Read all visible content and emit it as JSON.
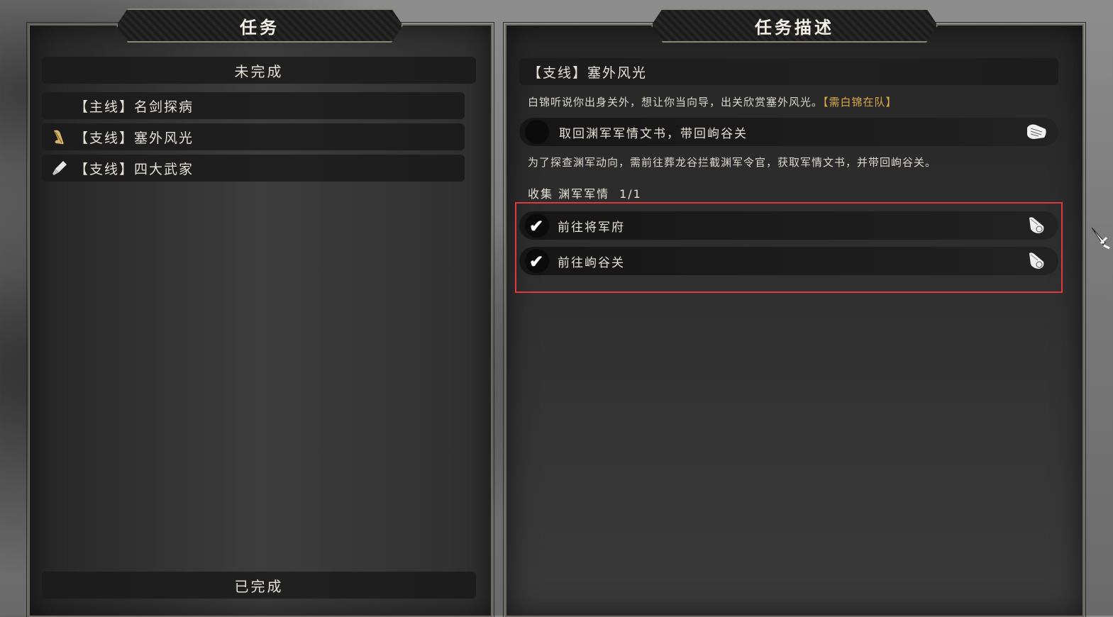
{
  "left_panel": {
    "title": "任务",
    "incomplete_header": "未完成",
    "quests": [
      {
        "label": "【主线】名剑探病",
        "icon": "none"
      },
      {
        "label": "【支线】塞外风光",
        "icon": "quill-scroll-icon"
      },
      {
        "label": "【支线】四大武家",
        "icon": "brush-icon"
      }
    ],
    "completed_header": "已完成"
  },
  "right_panel": {
    "title": "任务描述",
    "quest_title": "【支线】塞外风光",
    "quest_desc": "白锦听说你出身关外，想让你当向导，出关欣赏塞外风光。",
    "quest_req": "【需白锦在队】",
    "objective": {
      "label": "取回渊军军情文书，带回岣谷关",
      "desc": "为了探查渊军动向，需前往葬龙谷拦截渊军令官，获取军情文书，并带回岣谷关。"
    },
    "collect": {
      "label": "收集 渊军军情",
      "count": "1/1"
    },
    "subtasks": [
      {
        "label": "前往将军府",
        "done": true
      },
      {
        "label": "前往岣谷关",
        "done": true
      }
    ]
  },
  "colors": {
    "highlight": "#e0393c",
    "requirement": "#d9a94a"
  }
}
